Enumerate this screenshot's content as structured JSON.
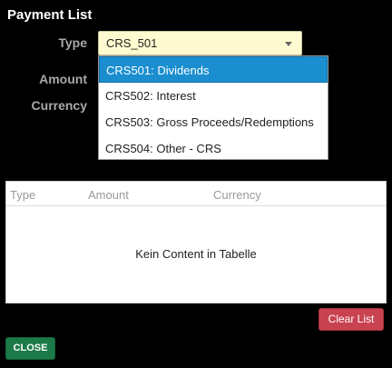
{
  "dialog": {
    "title": "Payment List"
  },
  "form": {
    "type_label": "Type",
    "amount_label": "Amount",
    "currency_label": "Currency",
    "type_value": "CRS_501"
  },
  "dropdown": {
    "options": [
      "CRS501: Dividends",
      "CRS502: Interest",
      "CRS503: Gross Proceeds/Redemptions",
      "CRS504: Other - CRS"
    ],
    "selected_index": 0
  },
  "table": {
    "columns": [
      "Type",
      "Amount",
      "Currency"
    ],
    "empty_message": "Kein Content in Tabelle"
  },
  "buttons": {
    "clear_list": "Clear List",
    "close": "CLOSE"
  },
  "colors": {
    "select_bg": "#fffbd0",
    "highlight": "#1a8ecf",
    "clear_button": "#c9424f",
    "close_button": "#1b7a47"
  }
}
